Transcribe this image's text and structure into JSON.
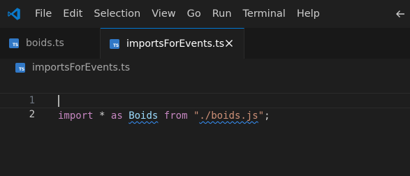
{
  "menu": {
    "items": [
      "File",
      "Edit",
      "Selection",
      "View",
      "Go",
      "Run",
      "Terminal",
      "Help"
    ]
  },
  "tabs": [
    {
      "label": "boids.ts",
      "active": false,
      "icon": "ts-file-icon"
    },
    {
      "label": "importsForEvents.ts",
      "active": true,
      "icon": "ts-file-icon"
    }
  ],
  "ts_badge_text": "TS",
  "breadcrumb": {
    "file": "importsForEvents.ts"
  },
  "editor": {
    "line_numbers": [
      "1",
      "2"
    ],
    "current_line": 2,
    "tokens": {
      "import_kw": "import",
      "star": "*",
      "as_kw": "as",
      "identifier": "Boids",
      "from_kw": "from",
      "quote_open": "\"",
      "path": "./boids.js",
      "quote_close": "\"",
      "semicolon": ";"
    }
  },
  "colors": {
    "accent": "#0078d4",
    "ts_badge": "#3178c6",
    "keyword": "#c586c0",
    "identifier": "#9cdcfe",
    "string": "#ce9178",
    "squiggle": "#3794ff"
  },
  "icons": {
    "app": "vscode-logo-icon",
    "back": "arrow-left-icon",
    "close": "close-icon"
  }
}
